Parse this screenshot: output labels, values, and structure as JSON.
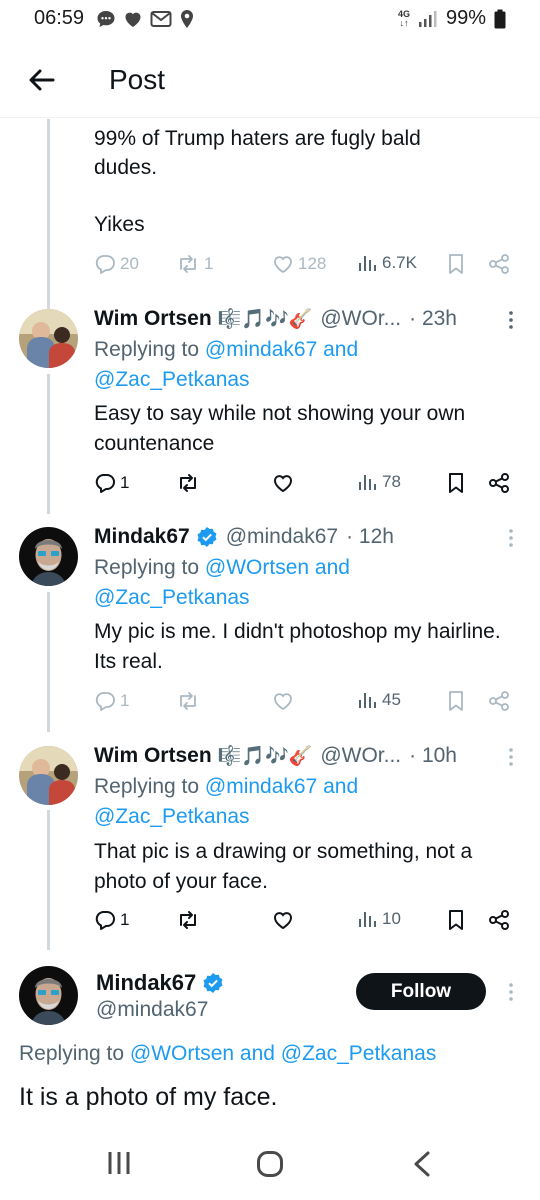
{
  "status_bar": {
    "time": "06:59",
    "network": "4G",
    "battery": "99%"
  },
  "header": {
    "title": "Post"
  },
  "prev_tweet": {
    "text_line1": "99% of Trump haters are fugly bald",
    "text_line2": "dudes.",
    "text_line3": "Yikes",
    "replies": "20",
    "reposts": "1",
    "likes": "128",
    "views": "6.7K"
  },
  "replies": [
    {
      "name": "Wim Ortsen",
      "emoji": "🎼🎵🎶🎸",
      "handle": "@WOr...",
      "time": "· 23h",
      "replying_prefix": "Replying to",
      "replying_line1": "@mindak67 and",
      "replying_line2": "@Zac_Petkanas",
      "body": "Easy to say while not showing your own countenance",
      "replies": "1",
      "views": "78"
    },
    {
      "name": "Mindak67",
      "handle": "@mindak67",
      "time": "· 12h",
      "replying_prefix": "Replying to",
      "replying_line1": "@WOrtsen and",
      "replying_line2": "@Zac_Petkanas",
      "body": "My pic is me.  I didn't photoshop my hairline.  Its real.",
      "replies": "1",
      "views": "45"
    },
    {
      "name": "Wim Ortsen",
      "emoji": "🎼🎵🎶🎸",
      "handle": "@WOr...",
      "time": "· 10h",
      "replying_prefix": "Replying to",
      "replying_line1": "@mindak67 and",
      "replying_line2": "@Zac_Petkanas",
      "body": "That pic is a drawing or something, not a photo of your face.",
      "replies": "1",
      "views": "10"
    }
  ],
  "main_tweet": {
    "name": "Mindak67",
    "handle": "@mindak67",
    "follow_label": "Follow",
    "replying_prefix": "Replying to",
    "replying_to": "@WOrtsen and @Zac_Petkanas",
    "body": "It is a photo of my face."
  },
  "colors": {
    "accent": "#1d9bf0",
    "secondary_text": "#536471",
    "primary_text": "#0f1419",
    "thread_line": "#cfd9de"
  }
}
